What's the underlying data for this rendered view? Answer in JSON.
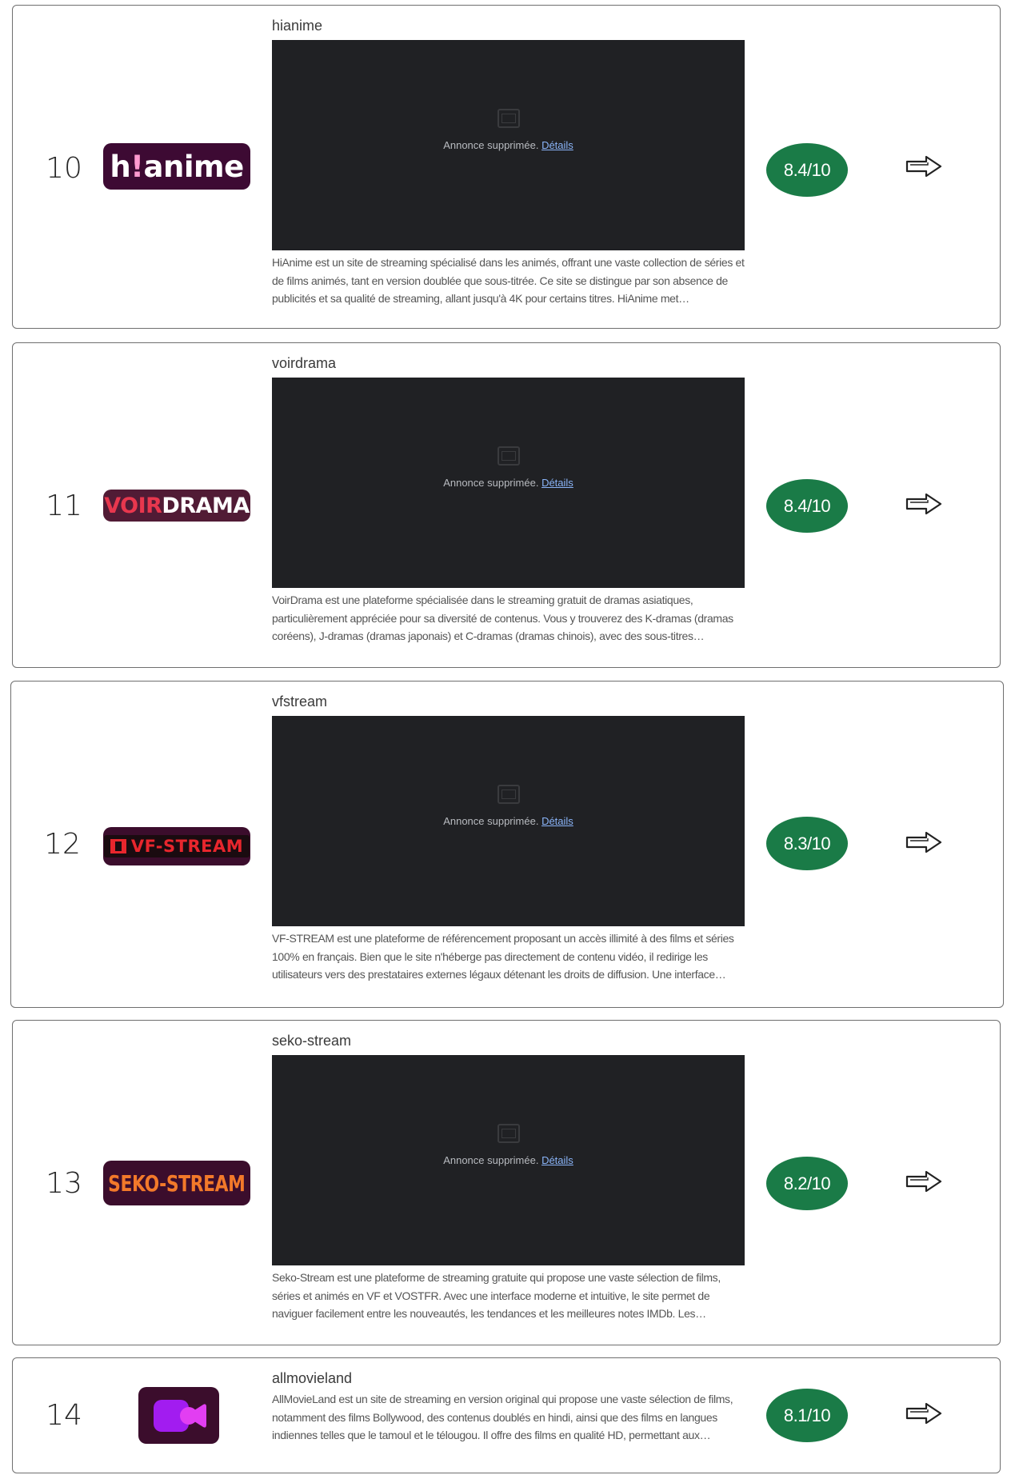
{
  "ad": {
    "removed_text": "Annonce supprimée.",
    "details_link": "Détails"
  },
  "items": [
    {
      "rank": "10",
      "name": "hianime",
      "logo": {
        "text_a": "h",
        "text_mark": "!",
        "text_b": "anime",
        "bg": "#3d0a33",
        "fg": "#ffffff",
        "accent": "#ff9ad0"
      },
      "description": "HiAnime est un site de streaming spécialisé dans les animés, offrant une vaste collection de séries et de films animés, tant en version doublée que sous-titrée. Ce site se distingue par son absence de publicités et sa qualité de streaming, allant jusqu'à 4K pour certains titres. HiAnime met…",
      "score": "8.4/10",
      "has_ad": true
    },
    {
      "rank": "11",
      "name": "voirdrama",
      "logo": {
        "text_a": "VOIR",
        "text_b": "DRAMA",
        "bg": "#511b35",
        "fg": "#ffffff",
        "accent": "#e8374e"
      },
      "description": "VoirDrama est une plateforme spécialisée dans le streaming gratuit de dramas asiatiques, particulièrement appréciée pour sa diversité de contenus. Vous y trouverez des K-dramas (dramas coréens), J-dramas (dramas japonais) et C-dramas (dramas chinois), avec des sous-titres…",
      "score": "8.4/10",
      "has_ad": true
    },
    {
      "rank": "12",
      "name": "vfstream",
      "logo": {
        "text_a": "VF-STREAM",
        "bg": "#3b0d2c",
        "fg": "#e8262d",
        "accent": "#1a0b10"
      },
      "description": "VF-STREAM est une plateforme de référencement proposant un accès illimité à des films et séries 100% en français. Bien que le site n'héberge pas directement de contenu vidéo, il redirige les utilisateurs vers des prestataires externes légaux détenant les droits de diffusion. Une interface…",
      "score": "8.3/10",
      "has_ad": true
    },
    {
      "rank": "13",
      "name": "seko-stream",
      "logo": {
        "text_a": "SEKO-STREAM",
        "bg": "#3b0d2c",
        "fg": "#f2792a"
      },
      "description": "Seko-Stream est une plateforme de streaming gratuite qui propose une vaste sélection de films, séries et animés en VF et VOSTFR. Avec une interface moderne et intuitive, le site permet de naviguer facilement entre les nouveautés, les tendances et les meilleures notes IMDb. Les…",
      "score": "8.2/10",
      "has_ad": true
    },
    {
      "rank": "14",
      "name": "allmovieland",
      "logo": {
        "bg": "#3b0d2c",
        "fg": "#a21cf0",
        "accent": "#e23ef2"
      },
      "description": "AllMovieLand est un site de streaming en version original qui propose une vaste sélection de films, notamment des films Bollywood, des contenus doublés en hindi, ainsi que des films en langues indiennes telles que le tamoul et le télougou. Il offre des films en qualité HD, permettant aux…",
      "score": "8.1/10",
      "has_ad": false
    }
  ]
}
